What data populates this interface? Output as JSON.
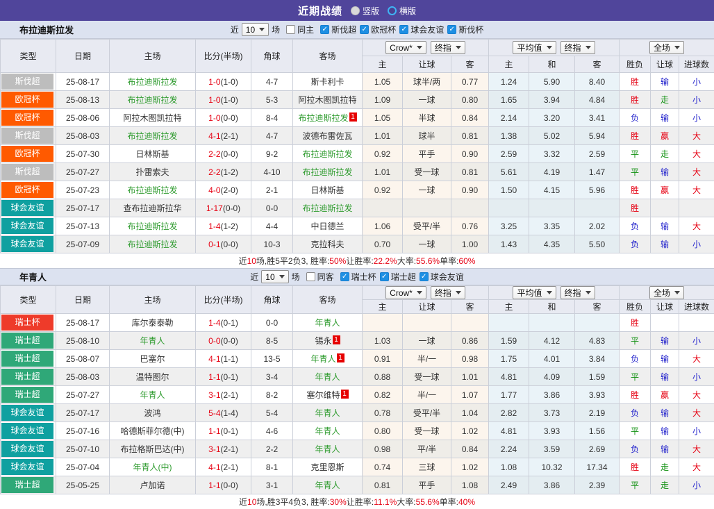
{
  "topbar": {
    "title": "近期战绩",
    "radio_vertical": {
      "label": "竖版",
      "selected": false
    },
    "radio_horizontal": {
      "label": "横版",
      "selected": true
    }
  },
  "columns": {
    "type": "类型",
    "date": "日期",
    "home": "主场",
    "score": "比分(半场)",
    "corner": "角球",
    "away": "客场",
    "sel_crow": "Crow*",
    "sel_final": "终指",
    "sel_avg": "平均值",
    "sel_final2": "终指",
    "sel_full": "全场",
    "asian_sub": [
      "主",
      "让球",
      "客"
    ],
    "euro_sub": [
      "主",
      "和",
      "客"
    ],
    "res_sub": [
      "胜负",
      "让球",
      "进球数"
    ]
  },
  "colors": {
    "league": {
      "斯伐超": "#BDBDBD",
      "欧冠杯": "#FF5A00",
      "球会友谊": "#0FA0A0",
      "瑞士杯": "#EE3B2A",
      "瑞士超": "#2FA878"
    },
    "result": {
      "胜": "#E60012",
      "赢": "#E60012",
      "大": "#E60012",
      "平": "#0E8F0E",
      "走": "#0E8F0E",
      "负": "#2222CC",
      "输": "#2222CC",
      "小": "#2222CC"
    },
    "team_green": "#2E9B2E",
    "score_red": "#E60012",
    "accent_purple": "#50459B"
  },
  "sections": [
    {
      "team": "布拉迪斯拉发",
      "filter": {
        "near": "近",
        "count": "10",
        "unit": "场",
        "venue": {
          "label": "同主",
          "checked": false
        },
        "leagues": [
          {
            "label": "斯伐超",
            "checked": true
          },
          {
            "label": "欧冠杯",
            "checked": true
          },
          {
            "label": "球会友谊",
            "checked": true
          },
          {
            "label": "斯伐杯",
            "checked": true
          }
        ]
      },
      "rows": [
        {
          "league": "斯伐超",
          "date": "25-08-17",
          "home": {
            "name": "布拉迪斯拉发",
            "green": true
          },
          "score": "1-0",
          "half": "(1-0)",
          "corner": "4-7",
          "away": {
            "name": "斯卡利卡",
            "green": false
          },
          "asian": [
            "1.05",
            "球半/两",
            "0.77"
          ],
          "euro": [
            "1.24",
            "5.90",
            "8.40"
          ],
          "result": [
            "胜",
            "输",
            "小"
          ]
        },
        {
          "league": "欧冠杯",
          "date": "25-08-13",
          "home": {
            "name": "布拉迪斯拉发",
            "green": true
          },
          "score": "1-0",
          "half": "(1-0)",
          "corner": "5-3",
          "away": {
            "name": "阿拉木图凯拉特",
            "green": false
          },
          "asian": [
            "1.09",
            "一球",
            "0.80"
          ],
          "euro": [
            "1.65",
            "3.94",
            "4.84"
          ],
          "result": [
            "胜",
            "走",
            "小"
          ]
        },
        {
          "league": "欧冠杯",
          "date": "25-08-06",
          "home": {
            "name": "阿拉木图凯拉特",
            "green": false
          },
          "score": "1-0",
          "half": "(0-0)",
          "corner": "8-4",
          "away": {
            "name": "布拉迪斯拉发",
            "green": true,
            "badge": "1"
          },
          "asian": [
            "1.05",
            "半球",
            "0.84"
          ],
          "euro": [
            "2.14",
            "3.20",
            "3.41"
          ],
          "result": [
            "负",
            "输",
            "小"
          ]
        },
        {
          "league": "斯伐超",
          "date": "25-08-03",
          "home": {
            "name": "布拉迪斯拉发",
            "green": true
          },
          "score": "4-1",
          "half": "(2-1)",
          "corner": "4-7",
          "away": {
            "name": "波德布雷佐瓦",
            "green": false
          },
          "asian": [
            "1.01",
            "球半",
            "0.81"
          ],
          "euro": [
            "1.38",
            "5.02",
            "5.94"
          ],
          "result": [
            "胜",
            "赢",
            "大"
          ]
        },
        {
          "league": "欧冠杯",
          "date": "25-07-30",
          "home": {
            "name": "日林斯基",
            "green": false
          },
          "score": "2-2",
          "half": "(0-0)",
          "corner": "9-2",
          "away": {
            "name": "布拉迪斯拉发",
            "green": true
          },
          "asian": [
            "0.92",
            "平手",
            "0.90"
          ],
          "euro": [
            "2.59",
            "3.32",
            "2.59"
          ],
          "result": [
            "平",
            "走",
            "大"
          ]
        },
        {
          "league": "斯伐超",
          "date": "25-07-27",
          "home": {
            "name": "扑雷索夫",
            "green": false
          },
          "score": "2-2",
          "half": "(1-2)",
          "corner": "4-10",
          "away": {
            "name": "布拉迪斯拉发",
            "green": true
          },
          "asian": [
            "1.01",
            "受一球",
            "0.81"
          ],
          "euro": [
            "5.61",
            "4.19",
            "1.47"
          ],
          "result": [
            "平",
            "输",
            "大"
          ]
        },
        {
          "league": "欧冠杯",
          "date": "25-07-23",
          "home": {
            "name": "布拉迪斯拉发",
            "green": true
          },
          "score": "4-0",
          "half": "(2-0)",
          "corner": "2-1",
          "away": {
            "name": "日林斯基",
            "green": false
          },
          "asian": [
            "0.92",
            "一球",
            "0.90"
          ],
          "euro": [
            "1.50",
            "4.15",
            "5.96"
          ],
          "result": [
            "胜",
            "赢",
            "大"
          ]
        },
        {
          "league": "球会友谊",
          "date": "25-07-17",
          "home": {
            "name": "查布拉迪斯拉华",
            "green": false
          },
          "score": "1-17",
          "half": "(0-0)",
          "corner": "0-0",
          "away": {
            "name": "布拉迪斯拉发",
            "green": true
          },
          "asian": [
            "",
            "",
            ""
          ],
          "euro": [
            "",
            "",
            ""
          ],
          "result": [
            "胜",
            "",
            ""
          ]
        },
        {
          "league": "球会友谊",
          "date": "25-07-13",
          "home": {
            "name": "布拉迪斯拉发",
            "green": true
          },
          "score": "1-4",
          "half": "(1-2)",
          "corner": "4-4",
          "away": {
            "name": "中日德兰",
            "green": false
          },
          "asian": [
            "1.06",
            "受平/半",
            "0.76"
          ],
          "euro": [
            "3.25",
            "3.35",
            "2.02"
          ],
          "result": [
            "负",
            "输",
            "大"
          ]
        },
        {
          "league": "球会友谊",
          "date": "25-07-09",
          "home": {
            "name": "布拉迪斯拉发",
            "green": true
          },
          "score": "0-1",
          "half": "(0-0)",
          "corner": "10-3",
          "away": {
            "name": "克拉科夫",
            "green": false
          },
          "asian": [
            "0.70",
            "一球",
            "1.00"
          ],
          "euro": [
            "1.43",
            "4.35",
            "5.50"
          ],
          "result": [
            "负",
            "输",
            "小"
          ]
        }
      ],
      "summary": [
        [
          "近",
          "k"
        ],
        [
          "10",
          "r"
        ],
        [
          "场,胜5平2负3, 胜率:",
          "k"
        ],
        [
          "50%",
          "r"
        ],
        [
          " 让胜率:",
          "k"
        ],
        [
          "22.2%",
          "r"
        ],
        [
          " 大率:",
          "k"
        ],
        [
          "55.6%",
          "r"
        ],
        [
          " 单率:",
          "k"
        ],
        [
          "60%",
          "r"
        ]
      ]
    },
    {
      "team": "年青人",
      "filter": {
        "near": "近",
        "count": "10",
        "unit": "场",
        "venue": {
          "label": "同客",
          "checked": false
        },
        "leagues": [
          {
            "label": "瑞士杯",
            "checked": true
          },
          {
            "label": "瑞士超",
            "checked": true
          },
          {
            "label": "球会友谊",
            "checked": true
          }
        ]
      },
      "rows": [
        {
          "league": "瑞士杯",
          "date": "25-08-17",
          "home": {
            "name": "库尔泰泰勒",
            "green": false
          },
          "score": "1-4",
          "half": "(0-1)",
          "corner": "0-0",
          "away": {
            "name": "年青人",
            "green": true
          },
          "asian": [
            "",
            "",
            ""
          ],
          "euro": [
            "",
            "",
            ""
          ],
          "result": [
            "胜",
            "",
            ""
          ]
        },
        {
          "league": "瑞士超",
          "date": "25-08-10",
          "home": {
            "name": "年青人",
            "green": true
          },
          "score": "0-0",
          "half": "(0-0)",
          "corner": "8-5",
          "away": {
            "name": "锡永",
            "green": false,
            "badge": "1"
          },
          "asian": [
            "1.03",
            "一球",
            "0.86"
          ],
          "euro": [
            "1.59",
            "4.12",
            "4.83"
          ],
          "result": [
            "平",
            "输",
            "小"
          ]
        },
        {
          "league": "瑞士超",
          "date": "25-08-07",
          "home": {
            "name": "巴塞尔",
            "green": false
          },
          "score": "4-1",
          "half": "(1-1)",
          "corner": "13-5",
          "away": {
            "name": "年青人",
            "green": true,
            "badge": "1"
          },
          "asian": [
            "0.91",
            "半/一",
            "0.98"
          ],
          "euro": [
            "1.75",
            "4.01",
            "3.84"
          ],
          "result": [
            "负",
            "输",
            "大"
          ]
        },
        {
          "league": "瑞士超",
          "date": "25-08-03",
          "home": {
            "name": "温特图尔",
            "green": false
          },
          "score": "1-1",
          "half": "(0-1)",
          "corner": "3-4",
          "away": {
            "name": "年青人",
            "green": true
          },
          "asian": [
            "0.88",
            "受一球",
            "1.01"
          ],
          "euro": [
            "4.81",
            "4.09",
            "1.59"
          ],
          "result": [
            "平",
            "输",
            "小"
          ]
        },
        {
          "league": "瑞士超",
          "date": "25-07-27",
          "home": {
            "name": "年青人",
            "green": true
          },
          "score": "3-1",
          "half": "(2-1)",
          "corner": "8-2",
          "away": {
            "name": "塞尔维特",
            "green": false,
            "badge": "1"
          },
          "asian": [
            "0.82",
            "半/一",
            "1.07"
          ],
          "euro": [
            "1.77",
            "3.86",
            "3.93"
          ],
          "result": [
            "胜",
            "赢",
            "大"
          ]
        },
        {
          "league": "球会友谊",
          "date": "25-07-17",
          "home": {
            "name": "波鸿",
            "green": false
          },
          "score": "5-4",
          "half": "(1-4)",
          "corner": "5-4",
          "away": {
            "name": "年青人",
            "green": true
          },
          "asian": [
            "0.78",
            "受平/半",
            "1.04"
          ],
          "euro": [
            "2.82",
            "3.73",
            "2.19"
          ],
          "result": [
            "负",
            "输",
            "大"
          ]
        },
        {
          "league": "球会友谊",
          "date": "25-07-16",
          "home": {
            "name": "哈德斯菲尔德(中)",
            "green": false
          },
          "score": "1-1",
          "half": "(0-1)",
          "corner": "4-6",
          "away": {
            "name": "年青人",
            "green": true
          },
          "asian": [
            "0.80",
            "受一球",
            "1.02"
          ],
          "euro": [
            "4.81",
            "3.93",
            "1.56"
          ],
          "result": [
            "平",
            "输",
            "小"
          ]
        },
        {
          "league": "球会友谊",
          "date": "25-07-10",
          "home": {
            "name": "布拉格斯巴达(中)",
            "green": false
          },
          "score": "3-1",
          "half": "(2-1)",
          "corner": "2-2",
          "away": {
            "name": "年青人",
            "green": true
          },
          "asian": [
            "0.98",
            "平/半",
            "0.84"
          ],
          "euro": [
            "2.24",
            "3.59",
            "2.69"
          ],
          "result": [
            "负",
            "输",
            "大"
          ]
        },
        {
          "league": "球会友谊",
          "date": "25-07-04",
          "home": {
            "name": "年青人(中)",
            "green": true
          },
          "score": "4-1",
          "half": "(2-1)",
          "corner": "8-1",
          "away": {
            "name": "克里恩斯",
            "green": false
          },
          "asian": [
            "0.74",
            "三球",
            "1.02"
          ],
          "euro": [
            "1.08",
            "10.32",
            "17.34"
          ],
          "result": [
            "胜",
            "走",
            "大"
          ]
        },
        {
          "league": "瑞士超",
          "date": "25-05-25",
          "home": {
            "name": "卢加诺",
            "green": false
          },
          "score": "1-1",
          "half": "(0-0)",
          "corner": "3-1",
          "away": {
            "name": "年青人",
            "green": true
          },
          "asian": [
            "0.81",
            "平手",
            "1.08"
          ],
          "euro": [
            "2.49",
            "3.86",
            "2.39"
          ],
          "result": [
            "平",
            "走",
            "小"
          ]
        }
      ],
      "summary": [
        [
          "近",
          "k"
        ],
        [
          "10",
          "r"
        ],
        [
          "场,胜3平4负3, 胜率:",
          "k"
        ],
        [
          "30%",
          "r"
        ],
        [
          " 让胜率:",
          "k"
        ],
        [
          "11.1%",
          "r"
        ],
        [
          " 大率:",
          "k"
        ],
        [
          "55.6%",
          "r"
        ],
        [
          " 单率:",
          "k"
        ],
        [
          "40%",
          "r"
        ]
      ]
    }
  ]
}
